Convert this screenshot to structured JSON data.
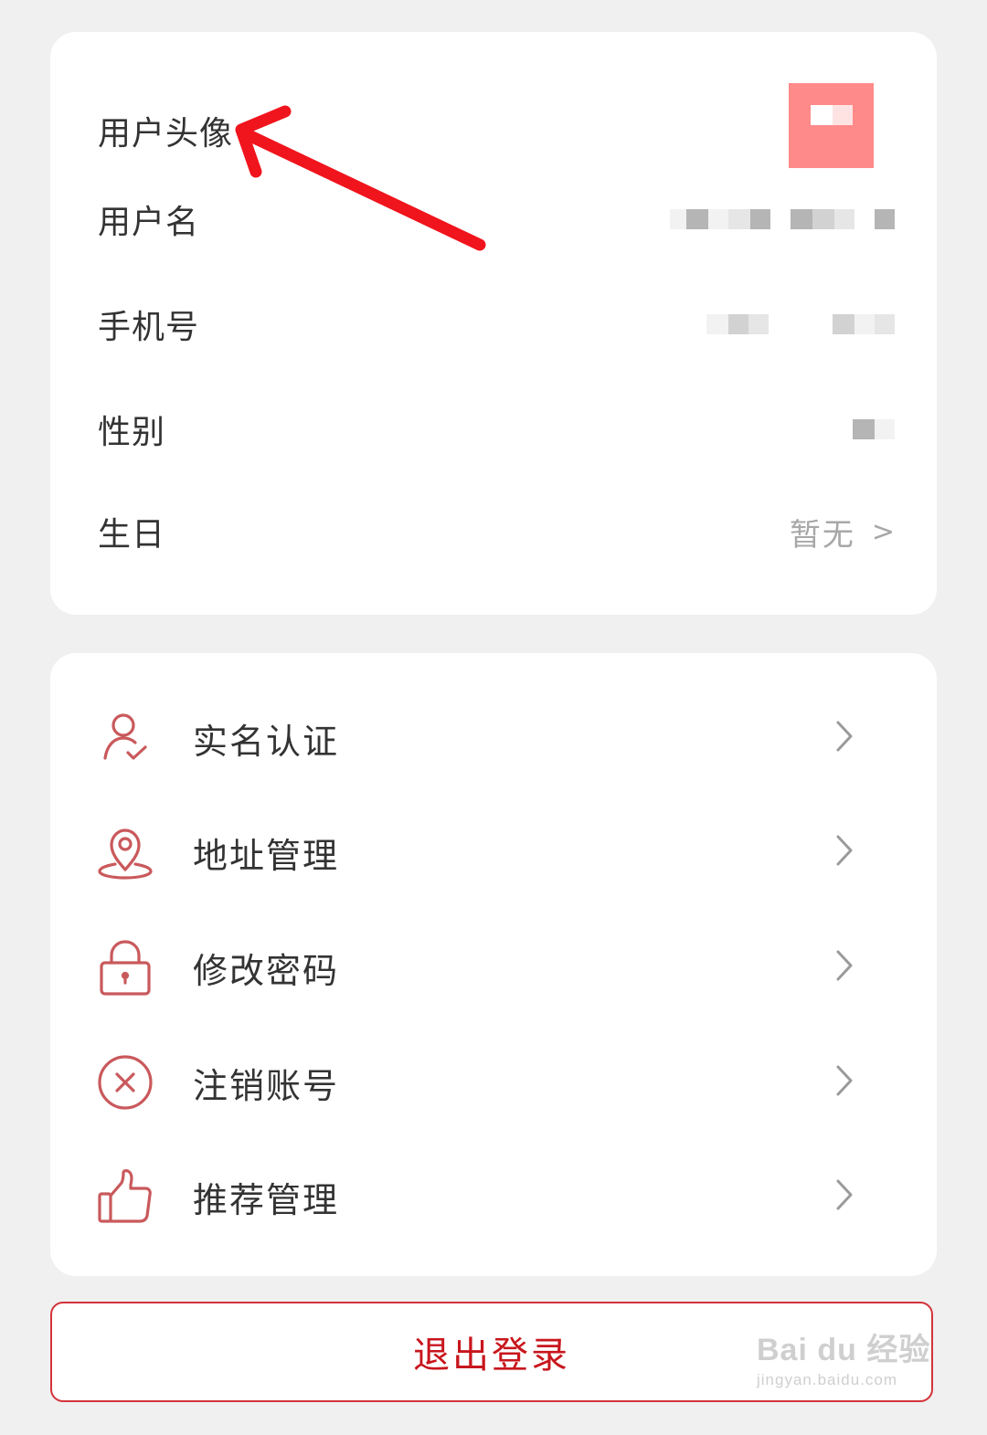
{
  "profile": {
    "avatar_label": "用户头像",
    "username_label": "用户名",
    "phone_label": "手机号",
    "gender_label": "性别",
    "birthday_label": "生日",
    "birthday_value": "暂无",
    "birthday_arrow": ">"
  },
  "menu": {
    "items": [
      {
        "label": "实名认证",
        "icon": "user-verify-icon"
      },
      {
        "label": "地址管理",
        "icon": "location-pin-icon"
      },
      {
        "label": "修改密码",
        "icon": "lock-icon"
      },
      {
        "label": "注销账号",
        "icon": "close-circle-icon"
      },
      {
        "label": "推荐管理",
        "icon": "thumbs-up-icon"
      }
    ]
  },
  "logout_label": "退出登录",
  "watermark": {
    "main": "Bai du 经验",
    "sub": "jingyan.baidu.com"
  },
  "colors": {
    "accent": "#c8161d",
    "icon": "#c9595c",
    "arrow": "#f0141c",
    "avatar": "#ff8a8a"
  }
}
